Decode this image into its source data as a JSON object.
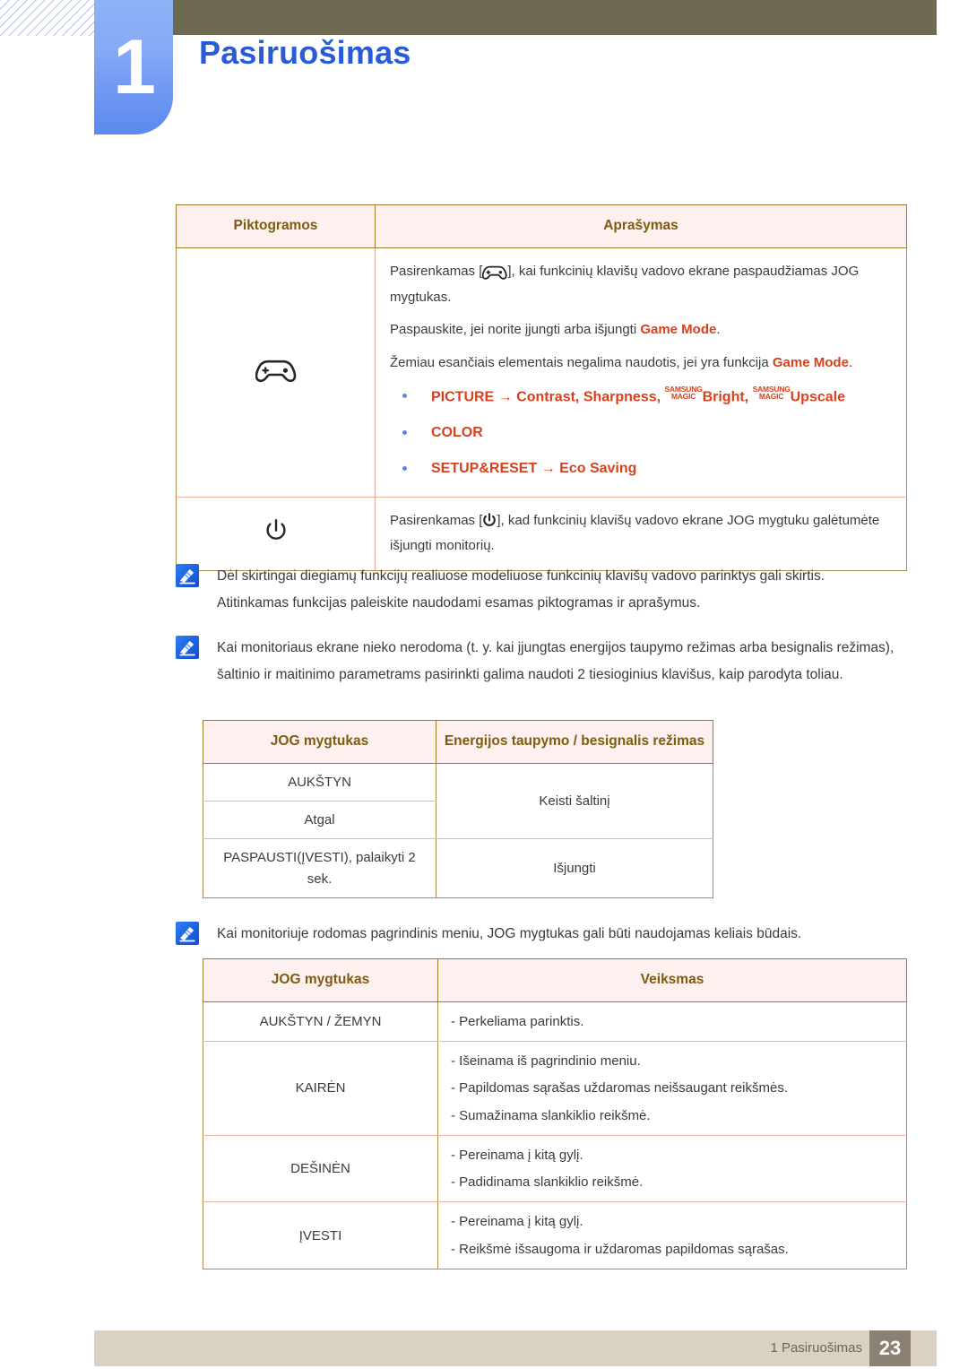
{
  "header": {
    "chapter_number": "1",
    "chapter_title": "Pasiruošimas"
  },
  "icon_table": {
    "headers": [
      "Piktogramos",
      "Aprašymas"
    ],
    "rows": [
      {
        "icon": "gamepad-icon",
        "paragraphs": [
          {
            "before": "Pasirenkamas [",
            "icon": "gamepad-icon",
            "after": "], kai funkcinių klavišų vadovo ekrane paspaudžiamas JOG mygtukas."
          },
          {
            "before": "Paspauskite, jei norite įjungti arba išjungti ",
            "highlight": "Game Mode",
            "after": "."
          },
          {
            "before": "Žemiau esančiais elementais negalima naudotis, jei yra funkcija ",
            "highlight": "Game Mode",
            "after": "."
          }
        ],
        "bullets": [
          {
            "head": "PICTURE",
            "arrow": "→",
            "tail_1": "Contrast, Sharpness, ",
            "magic_1_top": "SAMSUNG",
            "magic_1_bottom": "MAGIC",
            "word_1": "Bright",
            "sep": ", ",
            "magic_2_top": "SAMSUNG",
            "magic_2_bottom": "MAGIC",
            "word_2": "Upscale"
          },
          {
            "head": "COLOR"
          },
          {
            "head": "SETUP&RESET",
            "arrow": "→",
            "tail_1": "Eco Saving"
          }
        ]
      },
      {
        "icon": "power-icon",
        "paragraphs": [
          {
            "before": "Pasirenkamas [",
            "icon": "power-icon",
            "after": "], kad funkcinių klavišų vadovo ekrane JOG mygtuku galėtumėte išjungti monitorių."
          }
        ]
      }
    ]
  },
  "notes": [
    {
      "icon": "note-icon",
      "lines": [
        "Dėl skirtingai diegiamų funkcijų realiuose modeliuose funkcinių klavišų vadovo parinktys gali skirtis.",
        "Atitinkamas funkcijas paleiskite naudodami esamas piktogramas ir aprašymus."
      ]
    },
    {
      "icon": "note-icon",
      "lines": [
        "Kai monitoriaus ekrane nieko nerodoma (t. y. kai įjungtas energijos taupymo režimas arba besignalis režimas), šaltinio ir maitinimo parametrams pasirinkti galima naudoti 2 tiesioginius klavišus, kaip parodyta toliau."
      ]
    },
    {
      "icon": "note-icon",
      "lines": [
        "Kai monitoriuje rodomas pagrindinis meniu, JOG mygtukas gali būti naudojamas keliais būdais."
      ]
    }
  ],
  "power_table": {
    "headers": [
      "JOG mygtukas",
      "Energijos taupymo / besignalis režimas"
    ],
    "rows": [
      {
        "button": "AUKŠTYN",
        "action": "Keisti šaltinį"
      },
      {
        "button": "Atgal",
        "action": ""
      },
      {
        "button": "PASPAUSTI(ĮVESTI), palaikyti 2 sek.",
        "action": "Išjungti"
      }
    ]
  },
  "menu_table": {
    "headers": [
      "JOG mygtukas",
      "Veiksmas"
    ],
    "rows": [
      {
        "button": "AUKŠTYN / ŽEMYN",
        "actions": [
          "- Perkeliama parinktis."
        ]
      },
      {
        "button": "KAIRĖN",
        "actions": [
          "- Išeinama iš pagrindinio meniu.",
          "- Papildomas sąrašas uždaromas neišsaugant reikšmės.",
          "- Sumažinama slankiklio reikšmė."
        ]
      },
      {
        "button": "DEŠINĖN",
        "actions": [
          "- Pereinama į kitą gylį.",
          "- Padidinama slankiklio reikšmė."
        ]
      },
      {
        "button": "ĮVESTI",
        "actions": [
          "- Pereinama į kitą gylį.",
          "- Reikšmė išsaugoma ir uždaromas papildomas sąrašas."
        ]
      }
    ]
  },
  "footer": {
    "label": "1 Pasiruošimas",
    "page": "23"
  },
  "colors": {
    "accent_red": "#d8411e",
    "header_text": "#7d5c12",
    "header_bg": "#fdf0ee",
    "title_blue": "#2a5bd7",
    "topbar": "#6e6a52",
    "footer_bar": "#d9d2c2",
    "footer_page_bg": "#8c8075"
  }
}
